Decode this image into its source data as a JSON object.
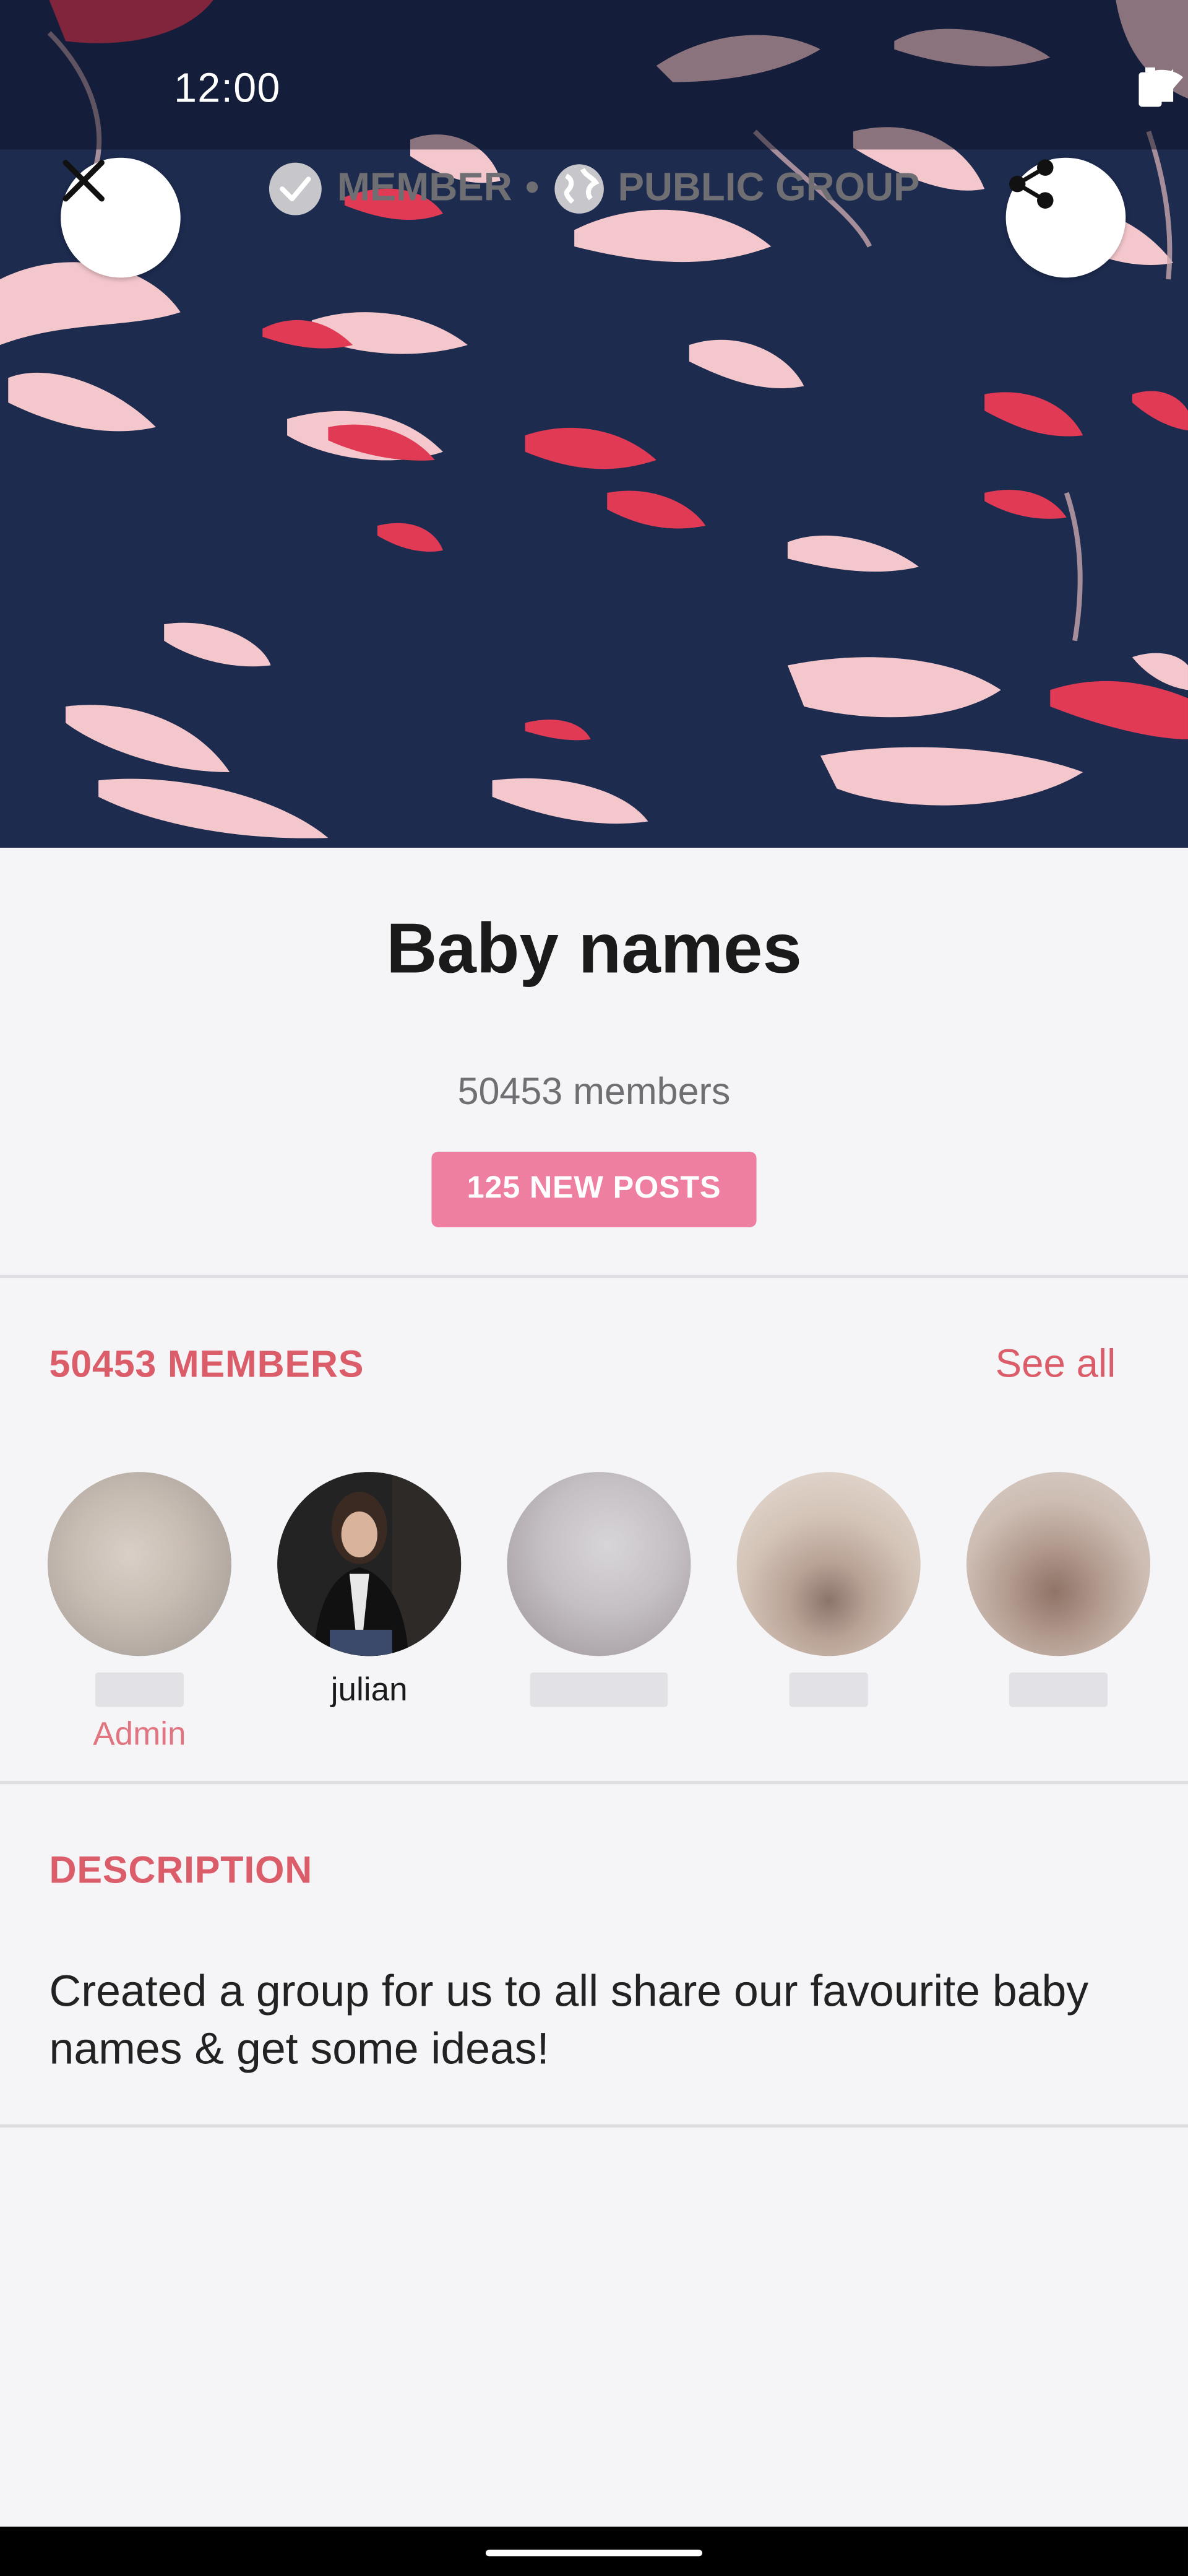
{
  "status_bar": {
    "time": "12:00"
  },
  "header": {
    "close_icon": "close-icon",
    "share_icon": "share-icon",
    "colors": {
      "background": "#1d2b4f",
      "pink": "#f4c7cc",
      "red": "#e03a55"
    }
  },
  "group": {
    "title": "Baby names",
    "member_label": "MEMBER",
    "separator": "•",
    "visibility_label": "PUBLIC GROUP",
    "members_count": "50453 members",
    "new_posts_label": "125 NEW POSTS"
  },
  "members_section": {
    "title": "50453 MEMBERS",
    "see_all": "See all",
    "members": [
      {
        "name": "",
        "role": "Admin",
        "avatar": "blurred"
      },
      {
        "name": "julian",
        "role": "",
        "avatar": "photo"
      },
      {
        "name": "",
        "role": "",
        "avatar": "blurred"
      },
      {
        "name": "",
        "role": "",
        "avatar": "blurred"
      },
      {
        "name": "",
        "role": "",
        "avatar": "blurred"
      }
    ]
  },
  "description_section": {
    "title": "DESCRIPTION",
    "text": "Created a group for us to all share our favourite baby names & get some ideas!"
  },
  "theme": {
    "accent": "#dc5d6a",
    "badge": "#ef7fa0",
    "page_bg": "#f5f5f8"
  }
}
